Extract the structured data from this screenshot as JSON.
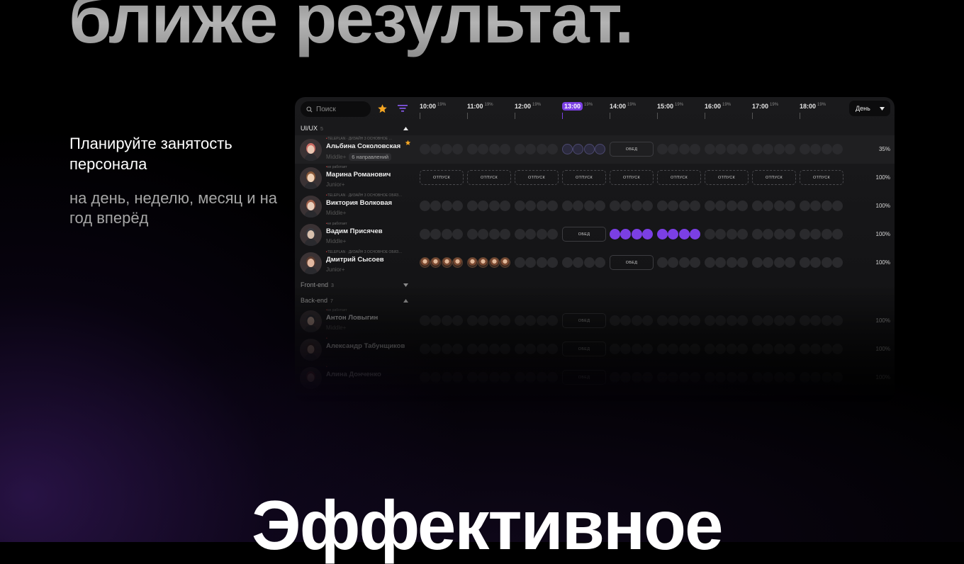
{
  "hero": {
    "top_line": "ближе результат.",
    "bottom_line": "Эффективное"
  },
  "left_copy": {
    "heading": "Планируйте занятость персонала",
    "subheading": "на день, неделю, месяц и на год вперёд"
  },
  "toolbar": {
    "search_placeholder": "Поиск",
    "view_select": "День",
    "accent_color": "#7b3fe4",
    "star_color": "#f5a623"
  },
  "timeline": {
    "hours": [
      {
        "time": "10:00",
        "pct": "19%"
      },
      {
        "time": "11:00",
        "pct": "19%"
      },
      {
        "time": "12:00",
        "pct": "19%"
      },
      {
        "time": "13:00",
        "pct": "19%",
        "active": true
      },
      {
        "time": "14:00",
        "pct": "19%"
      },
      {
        "time": "15:00",
        "pct": "19%"
      },
      {
        "time": "16:00",
        "pct": "19%"
      },
      {
        "time": "17:00",
        "pct": "19%"
      },
      {
        "time": "18:00",
        "pct": "19%"
      }
    ]
  },
  "groups": {
    "uiux": {
      "label": "UI/UX",
      "count": "5"
    },
    "frontend": {
      "label": "Front-end",
      "count": "3"
    },
    "backend": {
      "label": "Back-end",
      "count": "7"
    }
  },
  "labels": {
    "lunch": "ОБЕД",
    "vacation": "ОТПУСК"
  },
  "people": [
    {
      "name": "Альбина Соколовская",
      "meta": "TELEPLAN · ДИЗАЙН 3 ОСНОВНОЕ …",
      "level": "Middle+",
      "badge": "6 направлений",
      "pct": "35%",
      "favorite": true
    },
    {
      "name": "Марина Романович",
      "meta": "не работает",
      "level": "Junior+",
      "pct": "100%"
    },
    {
      "name": "Виктория Волковая",
      "meta": "TELEPLAN · ДИЗАЙН 3 ОСНОВНОЕ ОБЯЗ…",
      "level": "Middle+",
      "pct": "100%"
    },
    {
      "name": "Вадим Присячев",
      "meta": "не работает",
      "level": "Middle+",
      "pct": "100%"
    },
    {
      "name": "Дмитрий Сысоев",
      "meta": "TELEPLAN · ДИЗАЙН 3 ОСНОВНОЕ ОБЯЗ…",
      "level": "Junior+",
      "pct": "100%"
    },
    {
      "name": "Антон Ловыгин",
      "meta": "не работает",
      "level": "Middle+",
      "pct": "100%"
    },
    {
      "name": "Александр Табунщиков",
      "meta": "",
      "level": "",
      "pct": "100%"
    },
    {
      "name": "Алина Донченко",
      "meta": "",
      "level": "",
      "pct": "100%"
    }
  ]
}
